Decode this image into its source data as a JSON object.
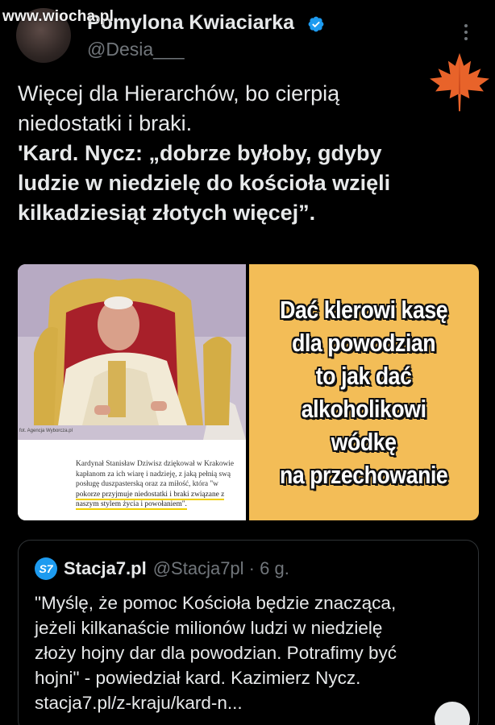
{
  "watermark": "www.wiocha.pl",
  "header": {
    "display_name": "Pomylona Kwiaciarka",
    "handle": "@Desia___"
  },
  "tweet": {
    "line1": "Więcej dla Hierarchów, bo cierpią",
    "line2": "niedostatki i braki.",
    "line3": "'Kard. Nycz: „dobrze byłoby, gdyby",
    "line4": "ludzie w niedzielę do kościoła wzięli",
    "line5": "kilkadziesiąt złotych więcej”."
  },
  "media_left": {
    "photo_caption": "fot. Agencja Wyborcza.pl",
    "article_line1": "Kardynał Stanisław Dziwisz dziękował w Krakowie",
    "article_line2": "kapłanom za ich wiarę i nadzieję, z jaką pełnią swą",
    "article_line3": "posługę duszpasterską oraz za miłość, która \"w",
    "article_line4": "pokorze przyjmuje niedostatki i braki związane z",
    "article_line5": "naszym stylem życia i powołaniem\"."
  },
  "media_right": {
    "lines": [
      "Dać klerowi kasę",
      "dla powodzian",
      "to jak dać",
      "alkoholikowi",
      "wódkę",
      "na przechowanie"
    ]
  },
  "quote": {
    "logo": "S7",
    "name": "Stacja7.pl",
    "meta": "@Stacja7pl · 6 g.",
    "line1": "\"Myślę, że pomoc Kościoła będzie znacząca,",
    "line2": "jeżeli kilkanaście milionów ludzi w niedzielę",
    "line3": "złoży hojny dar dla powodzian. Potrafimy być",
    "line4": "hojni\" - powiedział kard. Kazimierz Nycz.",
    "line5": "stacja7.pl/z-kraju/kard-n..."
  },
  "colors": {
    "background": "#000000",
    "verified": "#1d9bf0",
    "meme_bg": "#f3bd57",
    "highlight": "#f0d000"
  },
  "icons": [
    "verified-badge-icon",
    "more-options-icon",
    "maple-leaf-icon"
  ]
}
